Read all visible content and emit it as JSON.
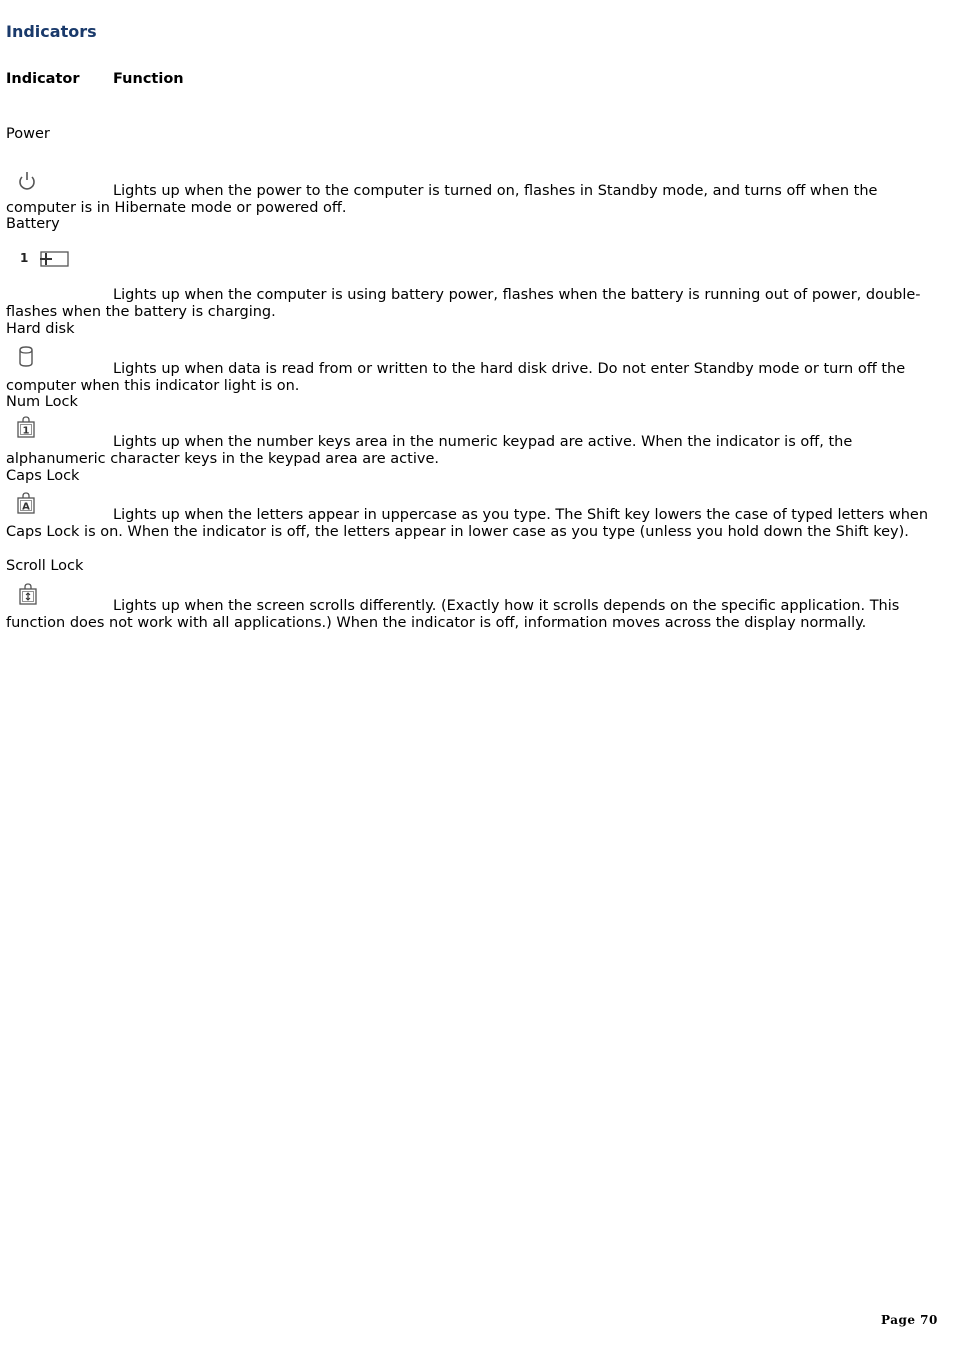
{
  "title": "Indicators",
  "table_headers": {
    "indicator": "Indicator",
    "function": "Function"
  },
  "entries": [
    {
      "label": "Power",
      "icon": "power-icon",
      "description": "Lights up when the power to the computer is turned on, flashes in Standby mode, and turns off when the computer is in Hibernate mode or powered off."
    },
    {
      "label": "Battery",
      "icon": "battery-icon",
      "icon_text": "1",
      "description": "Lights up when the computer is using battery power, flashes when the battery is running out of power, double-flashes when the battery is charging."
    },
    {
      "label": "Hard disk",
      "icon": "hard-disk-icon",
      "description": "Lights up when data is read from or written to the hard disk drive. Do not enter Standby mode or turn off the computer when this indicator light is on."
    },
    {
      "label": "Num Lock",
      "icon": "num-lock-icon",
      "icon_text": "1",
      "description": "Lights up when the number keys area in the numeric keypad are active. When the indicator is off, the alphanumeric character keys in the keypad area are active."
    },
    {
      "label": "Caps Lock",
      "icon": "caps-lock-icon",
      "icon_text": "A",
      "description": "Lights up when the letters appear in uppercase as you type. The Shift key lowers the case of typed letters when Caps Lock is on. When the indicator is off, the letters appear in lower case as you type (unless you hold down the Shift key)."
    },
    {
      "label": "Scroll Lock",
      "icon": "scroll-lock-icon",
      "icon_text": "↕",
      "description": "Lights up when the screen scrolls differently. (Exactly how it scrolls depends on the specific application. This function does not work with all applications.) When the indicator is off, information moves across the display normally."
    }
  ],
  "footer": {
    "page_label": "Page 70"
  }
}
